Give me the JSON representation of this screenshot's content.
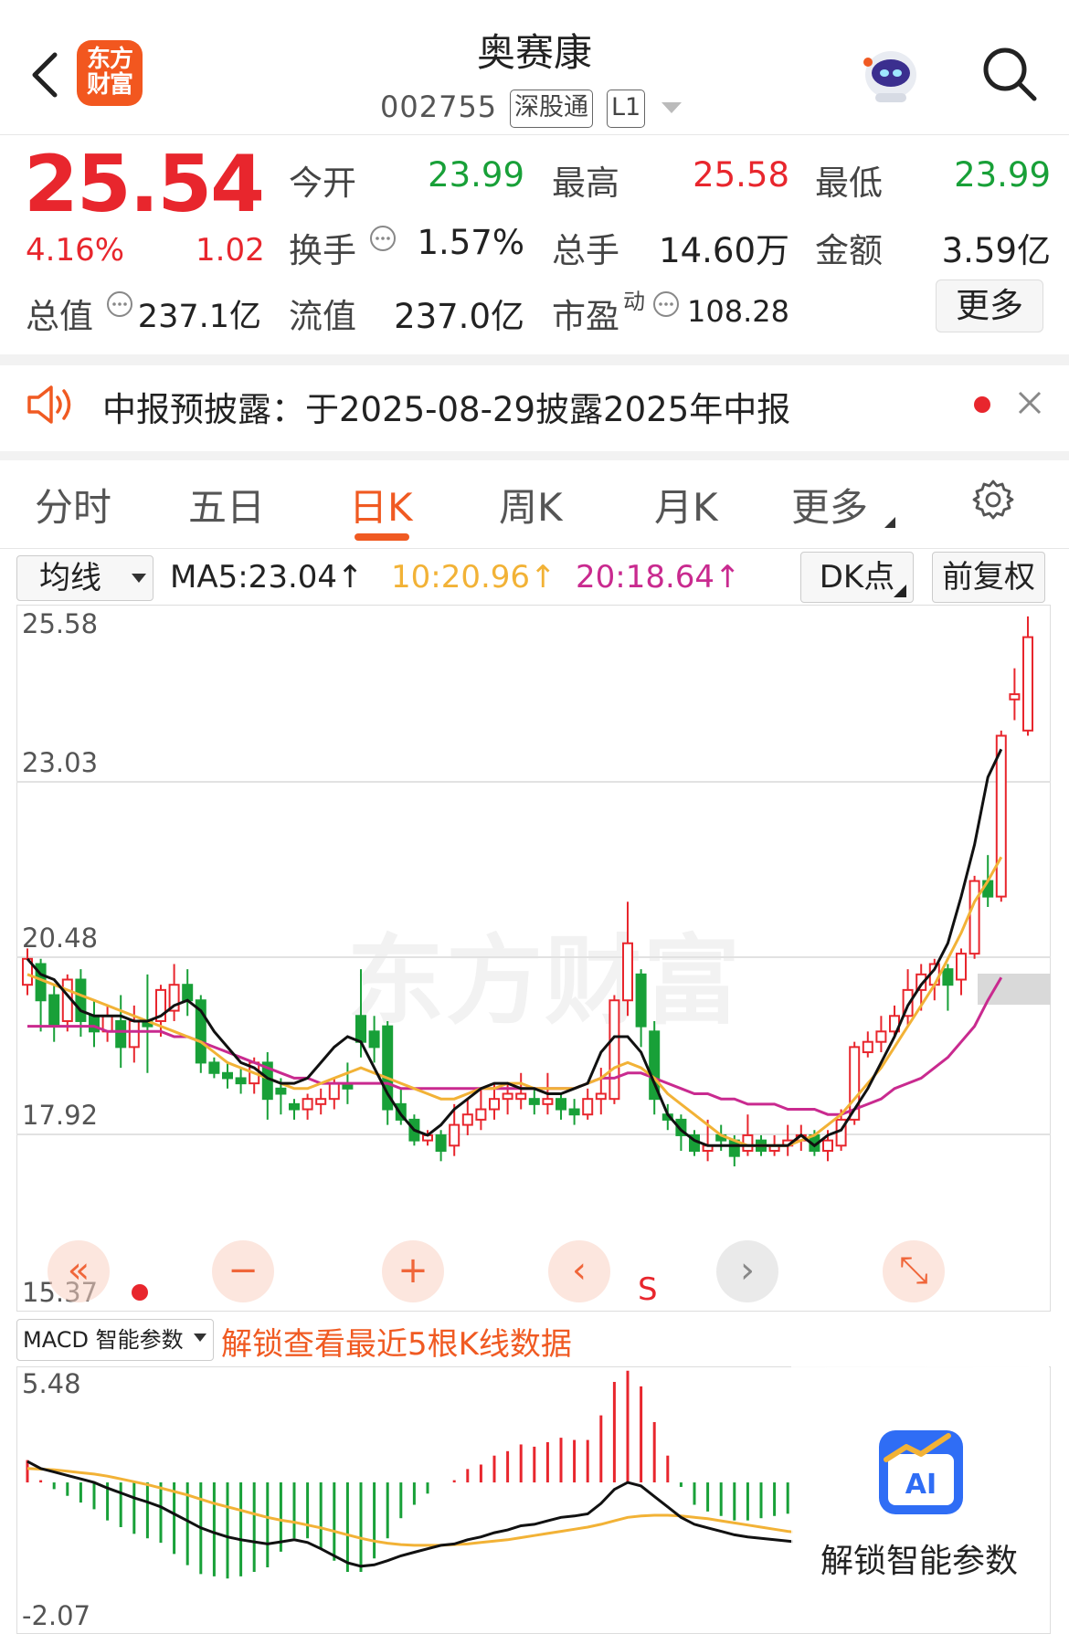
{
  "header": {
    "logo_line1": "东方",
    "logo_line2": "财富",
    "name": "奥赛康",
    "code": "002755",
    "market_tag": "深股通",
    "level_tag": "L1"
  },
  "quote": {
    "price": "25.54",
    "change_pct": "4.16%",
    "change": "1.02",
    "fields": [
      {
        "label": "今开",
        "value": "23.99",
        "color": "#18a038"
      },
      {
        "label": "最高",
        "value": "25.58",
        "color": "#e8262d"
      },
      {
        "label": "最低",
        "value": "23.99",
        "color": "#18a038"
      },
      {
        "label": "换手",
        "value": "1.57%"
      },
      {
        "label": "总手",
        "value": "14.60万"
      },
      {
        "label": "金额",
        "value": "3.59亿"
      },
      {
        "label": "总值",
        "value": "237.1亿"
      },
      {
        "label": "流值",
        "value": "237.0亿"
      },
      {
        "label": "市盈",
        "superscript": "动",
        "value": "108.28"
      }
    ],
    "more_label": "更多"
  },
  "notice": {
    "text": "中报预披露：于2025-08-29披露2025年中报"
  },
  "tabs": [
    "分时",
    "五日",
    "日K",
    "周K",
    "月K",
    "更多"
  ],
  "active_tab": "日K",
  "ma_bar": {
    "select_label": "均线",
    "ma5": "MA5:23.04",
    "ma10": "10:20.96",
    "ma20": "20:18.64",
    "arrow": "↑",
    "dk_label": "DK点",
    "adjust_label": "前复权"
  },
  "kline": {
    "watermark": "东方财富",
    "y_labels": [
      "25.58",
      "23.03",
      "20.48",
      "17.92",
      "15.37"
    ],
    "signal_label": "S",
    "controls": [
      "«",
      "−",
      "+",
      "‹",
      "›",
      "⤡"
    ],
    "colors": {
      "up": "#e8262d",
      "down": "#18a038",
      "ma5": "#111111",
      "ma10": "#f2b236",
      "ma20": "#c92a8f"
    },
    "ylim": [
      15.37,
      25.58
    ],
    "candles": [
      [
        18.5,
        19.0,
        18.3,
        19.2
      ],
      [
        18.9,
        18.2,
        17.6,
        19.0
      ],
      [
        18.3,
        17.7,
        17.4,
        18.5
      ],
      [
        17.8,
        18.6,
        17.6,
        18.7
      ],
      [
        18.6,
        17.8,
        17.5,
        18.8
      ],
      [
        17.9,
        17.6,
        17.3,
        18.2
      ],
      [
        17.6,
        17.9,
        17.4,
        18.1
      ],
      [
        17.8,
        17.3,
        16.9,
        18.3
      ],
      [
        17.3,
        17.8,
        17.0,
        18.1
      ],
      [
        17.8,
        17.7,
        16.8,
        18.7
      ],
      [
        17.8,
        18.4,
        17.5,
        18.5
      ],
      [
        18.0,
        18.5,
        17.8,
        18.9
      ],
      [
        18.5,
        18.2,
        17.9,
        18.8
      ],
      [
        18.2,
        17.0,
        16.8,
        18.3
      ],
      [
        17.0,
        16.8,
        16.7,
        17.1
      ],
      [
        16.8,
        16.7,
        16.5,
        17.0
      ],
      [
        16.7,
        16.6,
        16.4,
        16.9
      ],
      [
        16.6,
        17.0,
        16.4,
        17.1
      ],
      [
        17.0,
        16.3,
        15.9,
        17.2
      ],
      [
        16.5,
        16.4,
        16.0,
        16.7
      ],
      [
        16.2,
        16.1,
        15.9,
        16.3
      ],
      [
        16.1,
        16.3,
        15.9,
        16.4
      ],
      [
        16.2,
        16.3,
        16.0,
        16.5
      ],
      [
        16.3,
        16.6,
        16.1,
        16.7
      ],
      [
        16.6,
        16.5,
        16.2,
        17.0
      ],
      [
        17.9,
        17.4,
        17.1,
        18.8
      ],
      [
        17.6,
        17.3,
        17.0,
        17.9
      ],
      [
        17.7,
        16.1,
        15.8,
        17.8
      ],
      [
        16.2,
        15.9,
        15.8,
        16.5
      ],
      [
        15.9,
        15.5,
        15.4,
        16.0
      ],
      [
        15.5,
        15.6,
        15.4,
        15.7
      ],
      [
        15.6,
        15.3,
        15.1,
        15.7
      ],
      [
        15.4,
        15.8,
        15.2,
        16.2
      ],
      [
        15.8,
        16.0,
        15.6,
        16.3
      ],
      [
        15.9,
        16.1,
        15.7,
        16.5
      ],
      [
        16.1,
        16.3,
        15.9,
        16.6
      ],
      [
        16.3,
        16.4,
        16.0,
        16.6
      ],
      [
        16.3,
        16.4,
        16.1,
        16.8
      ],
      [
        16.3,
        16.2,
        16.0,
        16.5
      ],
      [
        16.2,
        16.3,
        16.0,
        16.8
      ],
      [
        16.3,
        16.1,
        15.9,
        16.4
      ],
      [
        16.1,
        16.0,
        15.8,
        16.3
      ],
      [
        16.0,
        16.3,
        15.9,
        16.5
      ],
      [
        16.3,
        16.4,
        16.0,
        16.9
      ],
      [
        16.3,
        18.2,
        16.2,
        18.3
      ],
      [
        18.2,
        19.3,
        17.9,
        20.1
      ],
      [
        18.7,
        17.7,
        17.3,
        18.8
      ],
      [
        17.6,
        16.3,
        16.0,
        17.8
      ],
      [
        16.0,
        15.9,
        15.7,
        16.2
      ],
      [
        15.9,
        15.6,
        15.3,
        16.0
      ],
      [
        15.6,
        15.3,
        15.2,
        15.7
      ],
      [
        15.3,
        15.4,
        15.1,
        15.9
      ],
      [
        15.6,
        15.5,
        15.3,
        15.8
      ],
      [
        15.5,
        15.2,
        15.0,
        15.6
      ],
      [
        15.3,
        15.6,
        15.2,
        16.0
      ],
      [
        15.5,
        15.3,
        15.2,
        15.6
      ],
      [
        15.3,
        15.4,
        15.2,
        15.6
      ],
      [
        15.4,
        15.5,
        15.2,
        15.8
      ],
      [
        15.5,
        15.6,
        15.3,
        15.8
      ],
      [
        15.6,
        15.3,
        15.2,
        15.7
      ],
      [
        15.3,
        15.5,
        15.1,
        15.7
      ],
      [
        15.4,
        15.9,
        15.3,
        16.1
      ],
      [
        15.9,
        17.3,
        15.8,
        17.4
      ],
      [
        17.2,
        17.4,
        17.1,
        17.6
      ],
      [
        17.4,
        17.6,
        17.2,
        17.9
      ],
      [
        17.6,
        17.9,
        17.5,
        18.1
      ],
      [
        17.9,
        18.4,
        17.7,
        18.8
      ],
      [
        18.4,
        18.7,
        18.0,
        18.9
      ],
      [
        18.5,
        18.9,
        18.2,
        19.0
      ],
      [
        18.8,
        18.5,
        18.0,
        18.9
      ],
      [
        18.6,
        19.1,
        18.3,
        19.2
      ],
      [
        19.1,
        20.5,
        19.0,
        20.6
      ],
      [
        20.5,
        20.2,
        20.0,
        21.0
      ],
      [
        20.2,
        23.3,
        20.1,
        23.4
      ],
      [
        24.0,
        24.1,
        23.6,
        24.6
      ],
      [
        23.4,
        25.2,
        23.3,
        25.6
      ]
    ],
    "ma5": [
      19.0,
      18.7,
      18.6,
      18.3,
      18.0,
      17.9,
      17.9,
      17.9,
      17.8,
      17.8,
      17.9,
      18.1,
      18.2,
      18.0,
      17.6,
      17.3,
      17.0,
      16.9,
      16.7,
      16.6,
      16.6,
      16.7,
      17.0,
      17.3,
      17.5,
      17.4,
      16.9,
      16.4,
      16.0,
      15.7,
      15.6,
      15.8,
      16.1,
      16.3,
      16.5,
      16.6,
      16.6,
      16.5,
      16.5,
      16.4,
      16.4,
      16.5,
      16.6,
      17.2,
      17.5,
      17.5,
      17.2,
      16.6,
      16.0,
      15.7,
      15.5,
      15.4,
      15.4,
      15.4,
      15.4,
      15.4,
      15.4,
      15.4,
      15.6,
      15.4,
      15.6,
      15.7,
      16.1,
      16.5,
      17.0,
      17.5,
      18.1,
      18.5,
      18.8,
      19.3,
      20.2,
      21.2,
      22.5,
      23.04
    ],
    "ma10": [
      18.7,
      18.6,
      18.5,
      18.4,
      18.3,
      18.2,
      18.1,
      18.0,
      17.9,
      17.8,
      17.7,
      17.6,
      17.5,
      17.4,
      17.2,
      17.0,
      16.9,
      16.8,
      16.7,
      16.6,
      16.5,
      16.5,
      16.6,
      16.7,
      16.8,
      16.9,
      16.8,
      16.7,
      16.6,
      16.5,
      16.4,
      16.3,
      16.3,
      16.4,
      16.5,
      16.5,
      16.6,
      16.6,
      16.5,
      16.5,
      16.5,
      16.5,
      16.6,
      16.7,
      16.9,
      17.0,
      16.9,
      16.7,
      16.4,
      16.2,
      16.0,
      15.8,
      15.6,
      15.5,
      15.4,
      15.4,
      15.4,
      15.4,
      15.5,
      15.6,
      15.8,
      16.0,
      16.3,
      16.6,
      16.9,
      17.3,
      17.7,
      18.1,
      18.5,
      19.0,
      19.5,
      20.1,
      20.5,
      20.96
    ],
    "ma20": [
      17.7,
      17.7,
      17.7,
      17.7,
      17.7,
      17.7,
      17.6,
      17.6,
      17.6,
      17.6,
      17.6,
      17.5,
      17.5,
      17.4,
      17.3,
      17.2,
      17.1,
      17.0,
      16.9,
      16.8,
      16.7,
      16.7,
      16.6,
      16.6,
      16.6,
      16.6,
      16.6,
      16.6,
      16.5,
      16.5,
      16.5,
      16.5,
      16.5,
      16.5,
      16.5,
      16.5,
      16.5,
      16.5,
      16.5,
      16.5,
      16.5,
      16.5,
      16.6,
      16.7,
      16.7,
      16.8,
      16.8,
      16.7,
      16.6,
      16.5,
      16.4,
      16.4,
      16.3,
      16.3,
      16.2,
      16.2,
      16.2,
      16.1,
      16.1,
      16.1,
      16.0,
      16.0,
      16.1,
      16.2,
      16.3,
      16.5,
      16.6,
      16.7,
      16.9,
      17.1,
      17.4,
      17.7,
      18.2,
      18.64
    ]
  },
  "macd": {
    "select_label": "MACD 智能参数",
    "unlock_text": "解锁查看最近5根K线数据",
    "y_labels": [
      "5.48",
      "-2.07"
    ],
    "ylim": [
      -2.07,
      5.48
    ],
    "dif": [
      0.3,
      0.2,
      0.15,
      0.1,
      0.05,
      0.0,
      -0.08,
      -0.15,
      -0.22,
      -0.28,
      -0.35,
      -0.45,
      -0.55,
      -0.65,
      -0.72,
      -0.78,
      -0.82,
      -0.85,
      -0.88,
      -0.85,
      -0.82,
      -0.86,
      -0.95,
      -1.05,
      -1.15,
      -1.2,
      -1.18,
      -1.12,
      -1.05,
      -1.0,
      -0.95,
      -0.9,
      -0.88,
      -0.82,
      -0.78,
      -0.72,
      -0.68,
      -0.62,
      -0.6,
      -0.55,
      -0.5,
      -0.48,
      -0.45,
      -0.3,
      -0.1,
      0.0,
      -0.05,
      -0.2,
      -0.35,
      -0.5,
      -0.6,
      -0.65,
      -0.7,
      -0.75,
      -0.78,
      -0.8,
      -0.82,
      -0.84,
      -0.86
    ],
    "dea": [
      0.2,
      0.19,
      0.18,
      0.16,
      0.14,
      0.12,
      0.09,
      0.05,
      0.01,
      -0.03,
      -0.08,
      -0.13,
      -0.18,
      -0.24,
      -0.3,
      -0.35,
      -0.4,
      -0.45,
      -0.5,
      -0.54,
      -0.57,
      -0.61,
      -0.65,
      -0.7,
      -0.75,
      -0.8,
      -0.84,
      -0.87,
      -0.89,
      -0.9,
      -0.9,
      -0.9,
      -0.89,
      -0.88,
      -0.86,
      -0.84,
      -0.82,
      -0.79,
      -0.76,
      -0.73,
      -0.7,
      -0.67,
      -0.64,
      -0.6,
      -0.55,
      -0.5,
      -0.48,
      -0.47,
      -0.47,
      -0.48,
      -0.5,
      -0.52,
      -0.55,
      -0.58,
      -0.61,
      -0.64,
      -0.67,
      -0.7,
      -0.72
    ],
    "hist": [
      0.2,
      0.02,
      -0.06,
      -0.12,
      -0.18,
      -0.24,
      -0.34,
      -0.4,
      -0.46,
      -0.5,
      -0.54,
      -0.64,
      -0.74,
      -0.82,
      -0.84,
      -0.86,
      -0.84,
      -0.8,
      -0.76,
      -0.62,
      -0.5,
      -0.5,
      -0.6,
      -0.7,
      -0.8,
      -0.8,
      -0.68,
      -0.5,
      -0.32,
      -0.2,
      -0.1,
      0.0,
      0.02,
      0.12,
      0.16,
      0.24,
      0.28,
      0.34,
      0.32,
      0.36,
      0.4,
      0.38,
      0.38,
      0.6,
      0.9,
      1.0,
      0.86,
      0.54,
      0.24,
      -0.04,
      -0.2,
      -0.26,
      -0.3,
      -0.34,
      -0.34,
      -0.32,
      -0.3,
      -0.28,
      -0.28
    ],
    "ai_unlock": "解锁智能参数",
    "ai_badge": "AI"
  }
}
